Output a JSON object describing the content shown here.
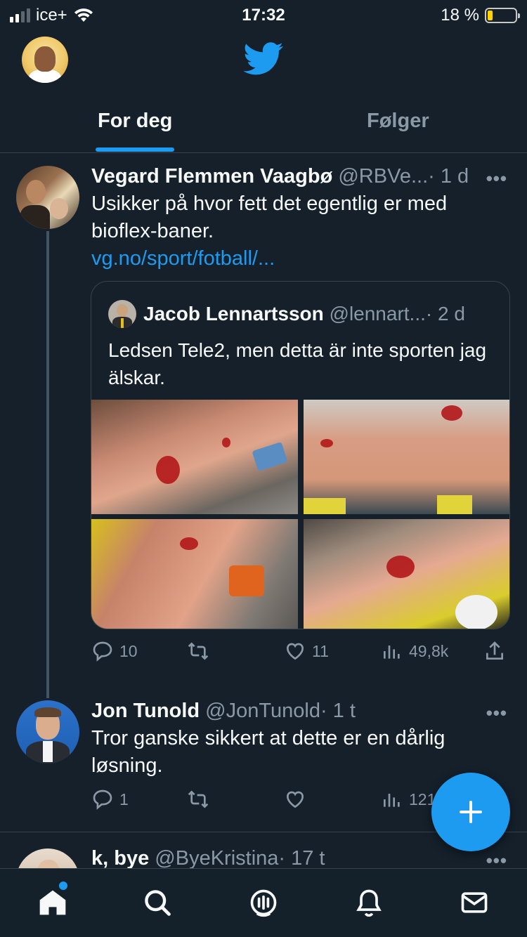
{
  "status_bar": {
    "carrier": "ice+",
    "time": "17:32",
    "battery": "18 %",
    "battery_level": 0.18
  },
  "header": {
    "tabs": [
      {
        "label": "For deg",
        "active": true
      },
      {
        "label": "Følger",
        "active": false
      }
    ]
  },
  "tweets": [
    {
      "name": "Vegard Flemmen Vaagbø",
      "handle": "@RBVe...",
      "time": "· 1 d",
      "more": "•••",
      "text": "Usikker på hvor fett det egentlig er med bioflex-baner.",
      "link": "vg.no/sport/fotball/...",
      "quote": {
        "name": "Jacob Lennartsson",
        "handle": "@lennart...",
        "time": "· 2 d",
        "text": "Ledsen Tele2, men detta är inte sporten jag älskar."
      },
      "stats": {
        "replies": "10",
        "retweets": "",
        "likes": "11",
        "views": "49,8k"
      }
    },
    {
      "name": "Jon Tunold",
      "handle": "@JonTunold",
      "time": "· 1 t",
      "more": "•••",
      "text": "Tror ganske sikkert at dette er en dårlig løsning.",
      "stats": {
        "replies": "1",
        "retweets": "",
        "likes": "",
        "views": "121"
      }
    },
    {
      "name": "k, bye",
      "handle": "@ByeKristina",
      "time": "· 17 t",
      "more": "•••"
    }
  ],
  "colors": {
    "background": "#15202b",
    "accent": "#1d9bf0",
    "muted": "#8b98a5",
    "divider": "#38444d"
  },
  "icons": {
    "nav": [
      "home-icon",
      "search-icon",
      "spaces-icon",
      "notifications-icon",
      "messages-icon"
    ],
    "fab": "compose-plus-icon"
  }
}
